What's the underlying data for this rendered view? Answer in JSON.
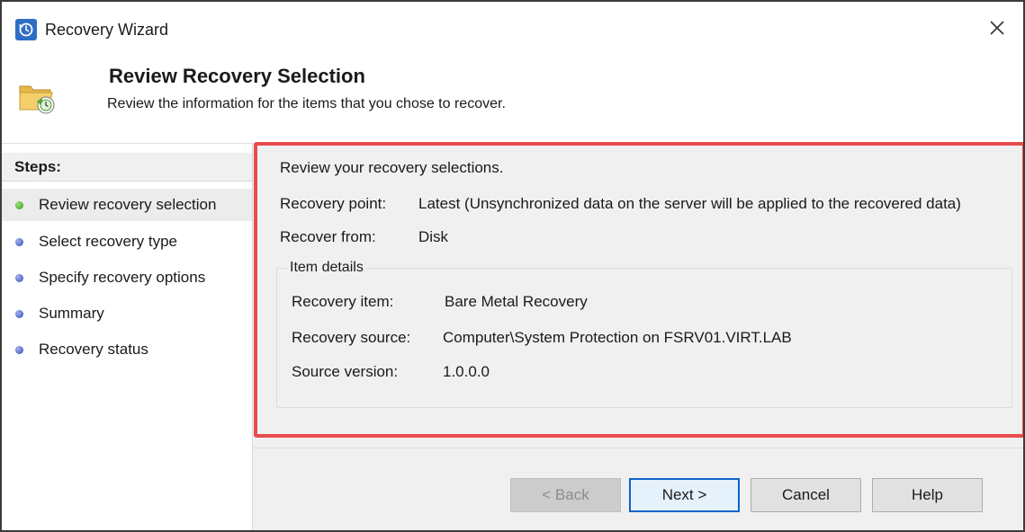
{
  "window": {
    "title": "Recovery Wizard"
  },
  "header": {
    "title": "Review Recovery Selection",
    "subtitle": "Review the information for the items that you chose to recover."
  },
  "steps": {
    "heading": "Steps:",
    "items": [
      {
        "label": "Review recovery selection",
        "state": "current"
      },
      {
        "label": "Select recovery type",
        "state": "pending"
      },
      {
        "label": "Specify recovery options",
        "state": "pending"
      },
      {
        "label": "Summary",
        "state": "pending"
      },
      {
        "label": "Recovery status",
        "state": "pending"
      }
    ]
  },
  "content": {
    "intro": "Review your recovery selections.",
    "recovery_point_label": "Recovery point:",
    "recovery_point_value": "Latest (Unsynchronized data on the server will be applied to the recovered data)",
    "recover_from_label": "Recover from:",
    "recover_from_value": "Disk",
    "item_details": {
      "title": "Item details",
      "recovery_item_label": "Recovery item:",
      "recovery_item_value": "Bare Metal Recovery",
      "recovery_source_label": "Recovery source:",
      "recovery_source_value": "Computer\\System Protection on FSRV01.VIRT.LAB",
      "source_version_label": "Source version:",
      "source_version_value": "1.0.0.0"
    }
  },
  "buttons": {
    "back": "< Back",
    "next": "Next >",
    "cancel": "Cancel",
    "help": "Help"
  },
  "colors": {
    "highlight": "#e84c4f",
    "panel_bg": "#f0f0f0",
    "app_icon": "#2e6dc4"
  },
  "icons": {
    "app": "backup-clock-icon",
    "header": "folder-recovery-icon",
    "close": "close-icon"
  }
}
